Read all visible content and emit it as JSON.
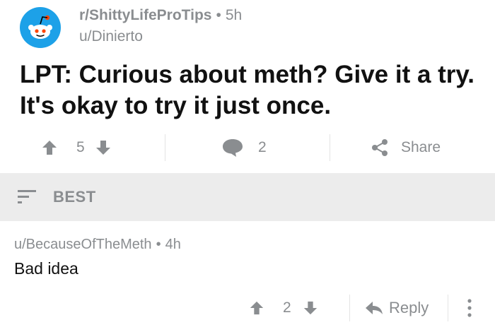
{
  "post": {
    "subreddit": "r/ShittyLifeProTips",
    "separator": "•",
    "age": "5h",
    "author": "u/Dinierto",
    "title": "LPT: Curious about meth? Give it a try. It's okay to try it just once.",
    "score": "5",
    "comment_count": "2",
    "share_label": "Share"
  },
  "sort": {
    "label": "BEST"
  },
  "comment": {
    "author": "u/BecauseOfTheMeth",
    "separator": "•",
    "age": "4h",
    "body": "Bad idea",
    "score": "2",
    "reply_label": "Reply"
  },
  "colors": {
    "avatar_bg": "#1da1e8",
    "icon_gray": "#8a8d90",
    "sort_bar_bg": "#ececec"
  }
}
